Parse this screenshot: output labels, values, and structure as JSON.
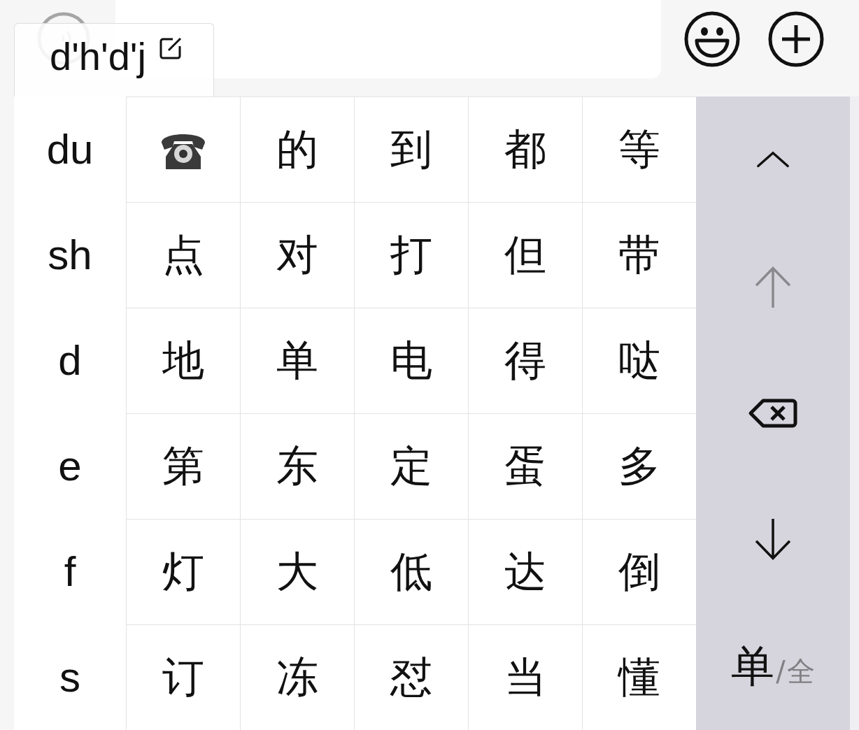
{
  "composition": {
    "text": "d'h'd'j"
  },
  "pinyin_options": [
    "du",
    "sh",
    "d",
    "e",
    "f",
    "s"
  ],
  "candidates": [
    {
      "kind": "icon"
    },
    {
      "kind": "text",
      "text": "的"
    },
    {
      "kind": "text",
      "text": "到"
    },
    {
      "kind": "text",
      "text": "都"
    },
    {
      "kind": "text",
      "text": "等"
    },
    {
      "kind": "text",
      "text": "点"
    },
    {
      "kind": "text",
      "text": "对"
    },
    {
      "kind": "text",
      "text": "打"
    },
    {
      "kind": "text",
      "text": "但"
    },
    {
      "kind": "text",
      "text": "带"
    },
    {
      "kind": "text",
      "text": "地"
    },
    {
      "kind": "text",
      "text": "单"
    },
    {
      "kind": "text",
      "text": "电"
    },
    {
      "kind": "text",
      "text": "得"
    },
    {
      "kind": "text",
      "text": "哒"
    },
    {
      "kind": "text",
      "text": "第"
    },
    {
      "kind": "text",
      "text": "东"
    },
    {
      "kind": "text",
      "text": "定"
    },
    {
      "kind": "text",
      "text": "蛋"
    },
    {
      "kind": "text",
      "text": "多"
    },
    {
      "kind": "text",
      "text": "灯"
    },
    {
      "kind": "text",
      "text": "大"
    },
    {
      "kind": "text",
      "text": "低"
    },
    {
      "kind": "text",
      "text": "达"
    },
    {
      "kind": "text",
      "text": "倒"
    },
    {
      "kind": "text",
      "text": "订"
    },
    {
      "kind": "text",
      "text": "冻"
    },
    {
      "kind": "text",
      "text": "怼"
    },
    {
      "kind": "text",
      "text": "当"
    },
    {
      "kind": "text",
      "text": "懂"
    }
  ],
  "side_keys": [
    {
      "kind": "collapse",
      "disabled": false
    },
    {
      "kind": "page-up",
      "disabled": true
    },
    {
      "kind": "delete",
      "disabled": false
    },
    {
      "kind": "page-down",
      "disabled": false
    }
  ],
  "width_toggle": {
    "separator": "/",
    "options": [
      {
        "label": "单",
        "selected": true
      },
      {
        "label": "全",
        "selected": false
      }
    ]
  }
}
